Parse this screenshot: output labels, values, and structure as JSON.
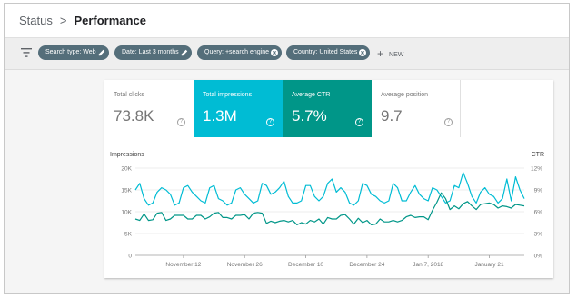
{
  "breadcrumb": {
    "root": "Status",
    "separator": ">",
    "current": "Performance"
  },
  "filters": {
    "chips": [
      {
        "label": "Search type: Web",
        "icon": "edit-icon"
      },
      {
        "label": "Date: Last 3 months",
        "icon": "edit-icon"
      },
      {
        "label": "Query: +search engine",
        "icon": "remove-icon"
      },
      {
        "label": "Country: United States",
        "icon": "remove-icon"
      }
    ],
    "new_label": "NEW",
    "chip_color": "#546e7a"
  },
  "metrics": [
    {
      "label": "Total clicks",
      "value": "73.8K",
      "selected": false,
      "color": "#ffffff"
    },
    {
      "label": "Total impressions",
      "value": "1.3M",
      "selected": true,
      "color": "#00bcd4"
    },
    {
      "label": "Average CTR",
      "value": "5.7%",
      "selected": true,
      "color": "#009688"
    },
    {
      "label": "Average position",
      "value": "9.7",
      "selected": false,
      "color": "#ffffff"
    }
  ],
  "help_glyph": "?",
  "chart_data": {
    "type": "line",
    "x": [
      "Nov 1",
      "Nov 2",
      "Nov 3",
      "Nov 4",
      "Nov 5",
      "Nov 6",
      "Nov 7",
      "Nov 8",
      "Nov 9",
      "Nov 10",
      "Nov 11",
      "Nov 12",
      "Nov 13",
      "Nov 14",
      "Nov 15",
      "Nov 16",
      "Nov 17",
      "Nov 18",
      "Nov 19",
      "Nov 20",
      "Nov 21",
      "Nov 22",
      "Nov 23",
      "Nov 24",
      "Nov 25",
      "Nov 26",
      "Nov 27",
      "Nov 28",
      "Nov 29",
      "Nov 30",
      "Dec 1",
      "Dec 2",
      "Dec 3",
      "Dec 4",
      "Dec 5",
      "Dec 6",
      "Dec 7",
      "Dec 8",
      "Dec 9",
      "Dec 10",
      "Dec 11",
      "Dec 12",
      "Dec 13",
      "Dec 14",
      "Dec 15",
      "Dec 16",
      "Dec 17",
      "Dec 18",
      "Dec 19",
      "Dec 20",
      "Dec 21",
      "Dec 22",
      "Dec 23",
      "Dec 24",
      "Dec 25",
      "Dec 26",
      "Dec 27",
      "Dec 28",
      "Dec 29",
      "Dec 30",
      "Dec 31",
      "Jan 1",
      "Jan 2",
      "Jan 3",
      "Jan 4",
      "Jan 5",
      "Jan 6",
      "Jan 7",
      "Jan 8",
      "Jan 9",
      "Jan 10",
      "Jan 11",
      "Jan 12",
      "Jan 13",
      "Jan 14",
      "Jan 15",
      "Jan 16",
      "Jan 17",
      "Jan 18",
      "Jan 19",
      "Jan 20",
      "Jan 21",
      "Jan 22",
      "Jan 23",
      "Jan 24",
      "Jan 25",
      "Jan 26",
      "Jan 27",
      "Jan 28",
      "Jan 29"
    ],
    "series": [
      {
        "name": "Impressions",
        "axis": "left",
        "color": "#00bcd4",
        "values": [
          15000,
          16500,
          13000,
          11500,
          12000,
          14500,
          15500,
          15000,
          14000,
          11500,
          12000,
          15500,
          16000,
          14500,
          13500,
          12500,
          12000,
          15500,
          16000,
          13000,
          12500,
          11500,
          12000,
          15000,
          15500,
          14000,
          13000,
          12000,
          12500,
          16500,
          16000,
          14000,
          14500,
          15500,
          17000,
          13500,
          12000,
          12000,
          12500,
          16000,
          16000,
          13500,
          12500,
          13500,
          16500,
          17500,
          14500,
          15500,
          14500,
          12000,
          11500,
          12500,
          16500,
          16000,
          14000,
          13500,
          12500,
          12000,
          12500,
          16500,
          15500,
          12500,
          12500,
          14500,
          16000,
          14000,
          13000,
          12500,
          15500,
          15000,
          13500,
          12000,
          12500,
          16000,
          15500,
          19000,
          16500,
          13500,
          12000,
          14500,
          15500,
          14000,
          13500,
          12000,
          13000,
          17500,
          12500,
          18000,
          15000,
          13000
        ]
      },
      {
        "name": "CTR",
        "axis": "right",
        "color": "#009688",
        "values": [
          5.0,
          4.8,
          5.7,
          4.8,
          4.9,
          5.8,
          5.9,
          4.8,
          5.0,
          5.5,
          5.5,
          5.5,
          5.0,
          5.0,
          5.5,
          5.5,
          5.0,
          5.3,
          5.8,
          5.9,
          5.2,
          5.2,
          5.0,
          5.5,
          5.5,
          5.6,
          5.0,
          5.8,
          5.9,
          5.8,
          4.4,
          4.7,
          4.5,
          4.7,
          4.8,
          4.6,
          4.8,
          4.2,
          4.5,
          4.3,
          4.8,
          4.6,
          5.0,
          4.3,
          5.2,
          5.0,
          5.0,
          5.5,
          5.6,
          5.0,
          4.3,
          5.1,
          4.5,
          4.8,
          4.2,
          4.3,
          5.0,
          4.6,
          4.6,
          4.8,
          4.6,
          4.8,
          5.3,
          5.5,
          5.2,
          5.3,
          5.3,
          4.9,
          6.2,
          7.3,
          8.6,
          7.8,
          6.3,
          6.8,
          6.4,
          7.1,
          7.4,
          6.8,
          6.3,
          7.0,
          7.1,
          7.2,
          7.0,
          6.5,
          6.8,
          6.7,
          6.5,
          7.0,
          6.9,
          6.8
        ]
      }
    ],
    "left_axis": {
      "title": "Impressions",
      "ticks": [
        "0",
        "5K",
        "10K",
        "15K",
        "20K"
      ],
      "ylim": [
        0,
        20000
      ]
    },
    "right_axis": {
      "title": "CTR",
      "ticks": [
        "0%",
        "3%",
        "6%",
        "9%",
        "12%"
      ],
      "ylim": [
        0,
        12
      ]
    },
    "x_tick_labels": [
      {
        "label": "November 12",
        "date": "Nov 12"
      },
      {
        "label": "November 26",
        "date": "Nov 26"
      },
      {
        "label": "December 10",
        "date": "Dec 10"
      },
      {
        "label": "December 24",
        "date": "Dec 24"
      },
      {
        "label": "Jan 7, 2018",
        "date": "Jan 7"
      },
      {
        "label": "January 21",
        "date": "Jan 21"
      }
    ],
    "grid": true,
    "legend": "none"
  }
}
